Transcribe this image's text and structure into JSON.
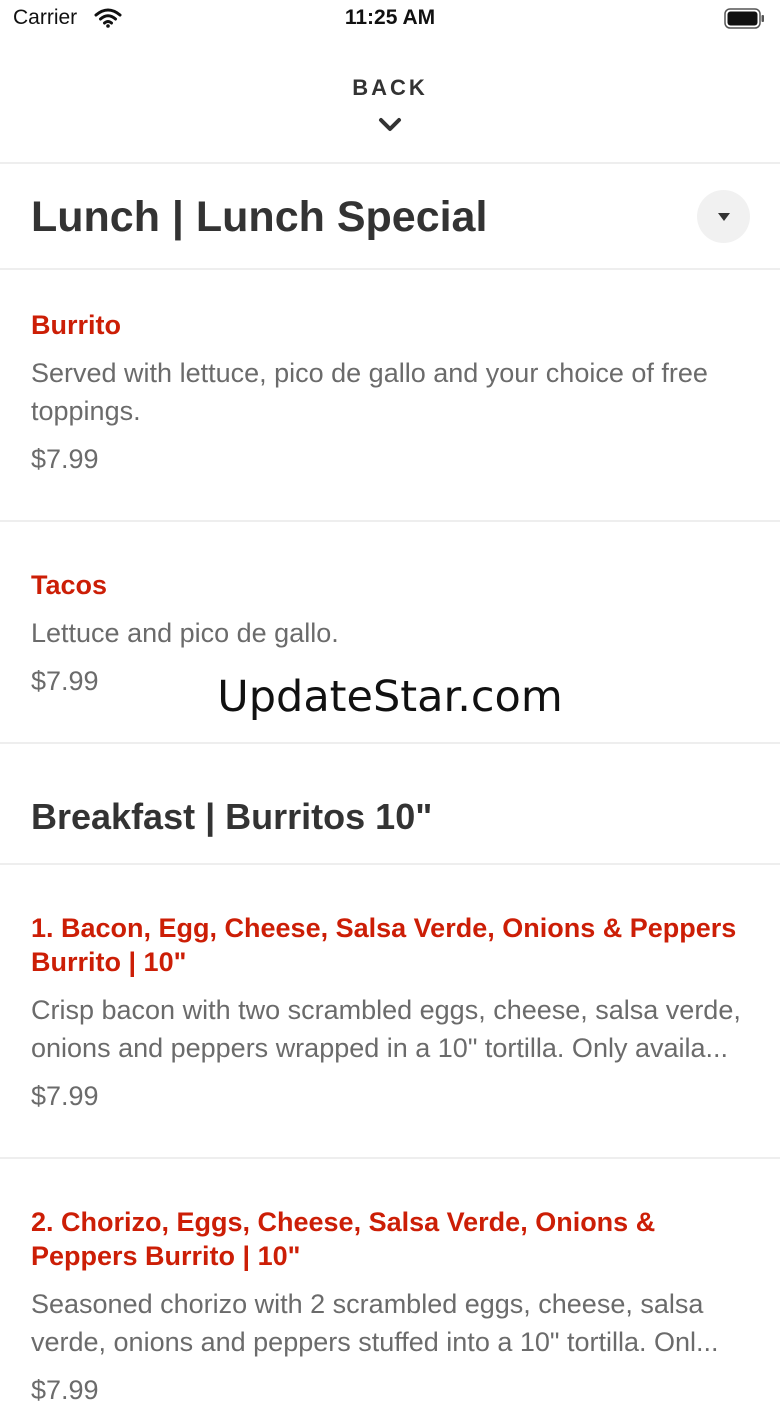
{
  "status_bar": {
    "carrier": "Carrier",
    "time": "11:25 AM"
  },
  "nav": {
    "back_label": "BACK"
  },
  "sections": [
    {
      "title": "Lunch | Lunch Special",
      "items": [
        {
          "name": "Burrito",
          "description": "Served with lettuce, pico de gallo and your choice of free toppings.",
          "price": "$7.99"
        },
        {
          "name": "Tacos",
          "description": "Lettuce and pico de gallo.",
          "price": "$7.99"
        }
      ]
    },
    {
      "title": "Breakfast | Burritos 10\"",
      "items": [
        {
          "name": "1. Bacon, Egg, Cheese, Salsa Verde, Onions & Peppers Burrito | 10\"",
          "description": "Crisp bacon with two scrambled eggs, cheese, salsa verde, onions and peppers wrapped in a 10\" tortilla. Only availa...",
          "price": "$7.99"
        },
        {
          "name": "2. Chorizo, Eggs, Cheese, Salsa Verde, Onions & Peppers Burrito | 10\"",
          "description": "Seasoned chorizo with 2 scrambled eggs, cheese, salsa verde, onions and peppers stuffed into a 10\" tortilla. Onl...",
          "price": "$7.99"
        }
      ]
    }
  ],
  "watermark": "UpdateStar.com",
  "colors": {
    "item_name": "#cc1e06",
    "text": "#333333",
    "muted": "#6b6b6b",
    "divider": "#eeeeee"
  },
  "icons": {
    "wifi": "wifi-icon",
    "battery": "battery-icon",
    "back": "chevron-down-icon",
    "dropdown": "caret-down-icon"
  }
}
